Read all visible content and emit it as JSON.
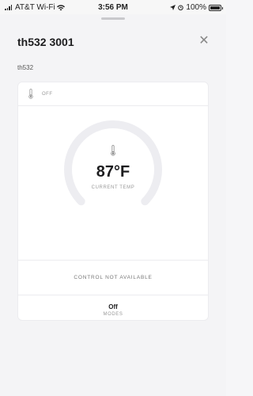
{
  "status_bar": {
    "carrier": "AT&T Wi-Fi",
    "time": "3:56 PM",
    "battery": "100%",
    "battery_level": 1.0
  },
  "sheet": {
    "title": "th532 3001",
    "subtitle": "th532",
    "close_icon": "close-icon"
  },
  "card": {
    "header_status": "OFF",
    "current_temp": "87°F",
    "current_temp_label": "CURRENT TEMP",
    "control_message": "CONTROL NOT AVAILABLE",
    "mode_value": "Off",
    "mode_label": "MODES"
  },
  "colors": {
    "dial_track": "#ededf1",
    "background": "#f4f4f6",
    "card": "#ffffff"
  }
}
